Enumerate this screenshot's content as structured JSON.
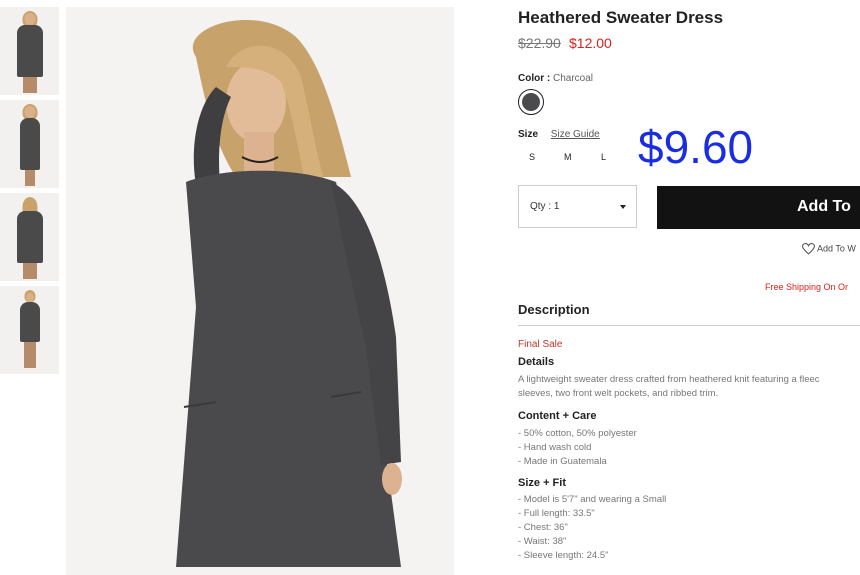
{
  "product": {
    "title": "Heathered Sweater Dress",
    "old_price": "$22.90",
    "sale_price": "$12.00",
    "promo_price": "$9.60"
  },
  "color": {
    "label": "Color :",
    "value": "Charcoal",
    "swatch_hex": "#4b4b4d"
  },
  "size": {
    "label": "Size",
    "guide": "Size Guide",
    "options": [
      "S",
      "M",
      "L"
    ]
  },
  "qty": {
    "label": "Qty : 1"
  },
  "buttons": {
    "add": "Add To",
    "wishlist": "Add To W"
  },
  "shipping": "Free Shipping On Or",
  "description": {
    "heading": "Description",
    "final_sale": "Final Sale",
    "details_h": "Details",
    "details_lines": [
      "A lightweight sweater dress crafted from heathered knit featuring a fleec",
      "sleeves, two front welt pockets, and ribbed trim."
    ],
    "content_h": "Content + Care",
    "content_lines": [
      "- 50% cotton, 50% polyester",
      "- Hand wash cold",
      "- Made in Guatemala"
    ],
    "fit_h": "Size + Fit",
    "fit_lines": [
      "- Model is 5'7\" and wearing a Small",
      "- Full length: 33.5\"",
      "- Chest: 36\"",
      "- Waist: 38\"",
      "- Sleeve length: 24.5\""
    ]
  },
  "colors": {
    "accent_price": "#1a2de0",
    "sale": "#e0201b",
    "dress": "#4a4a4a"
  }
}
